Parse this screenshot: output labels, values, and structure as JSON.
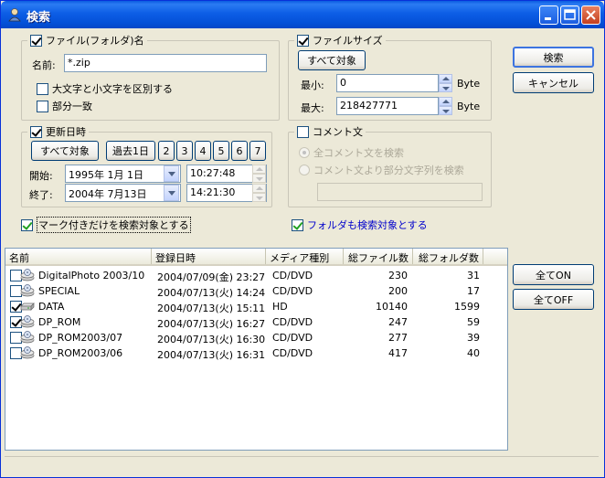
{
  "window": {
    "title": "検索"
  },
  "file_group": {
    "legend": "ファイル(フォルダ)名",
    "name_label": "名前:",
    "name_value": "*.zip",
    "case_label": "大文字と小文字を区別する",
    "partial_label": "部分一致"
  },
  "size_group": {
    "legend": "ファイルサイズ",
    "all_button": "すべて対象",
    "min_label": "最小:",
    "min_value": "0",
    "max_label": "最大:",
    "max_value": "218427771",
    "unit": "Byte"
  },
  "date_group": {
    "legend": "更新日時",
    "all_button": "すべて対象",
    "past_button": "過去1日",
    "day_buttons": [
      "2",
      "3",
      "4",
      "5",
      "6",
      "7"
    ],
    "start_label": "開始:",
    "start_date": "1995年  1月  1日",
    "start_time": "10:27:48",
    "end_label": "終了:",
    "end_date": "2004年  7月13日",
    "end_time": "14:21:30"
  },
  "comment_group": {
    "legend": "コメント文",
    "option_all": "全コメント文を検索",
    "option_partial": "コメント文より部分文字列を検索",
    "text_value": ""
  },
  "options": {
    "marked_only": "マーク付きだけを検索対象とする",
    "include_folders": "フォルダも検索対象とする"
  },
  "buttons": {
    "search": "検索",
    "cancel": "キャンセル",
    "all_on": "全てON",
    "all_off": "全てOFF"
  },
  "list": {
    "columns": [
      "名前",
      "登録日時",
      "メディア種別",
      "総ファイル数",
      "総フォルダ数"
    ],
    "rows": [
      {
        "checked": false,
        "name": "DigitalPhoto 2003/10",
        "date": "2004/07/09(金) 23:27",
        "media": "CD/DVD",
        "files": "230",
        "folders": "31"
      },
      {
        "checked": false,
        "name": "SPECIAL",
        "date": "2004/07/13(火) 14:24",
        "media": "CD/DVD",
        "files": "200",
        "folders": "17"
      },
      {
        "checked": true,
        "name": "DATA",
        "date": "2004/07/13(火) 15:11",
        "media": "HD",
        "files": "10140",
        "folders": "1599"
      },
      {
        "checked": true,
        "name": "DP_ROM",
        "date": "2004/07/13(火) 16:27",
        "media": "CD/DVD",
        "files": "247",
        "folders": "59"
      },
      {
        "checked": false,
        "name": "DP_ROM2003/07",
        "date": "2004/07/13(火) 16:30",
        "media": "CD/DVD",
        "files": "277",
        "folders": "39"
      },
      {
        "checked": false,
        "name": "DP_ROM2003/06",
        "date": "2004/07/13(火) 16:31",
        "media": "CD/DVD",
        "files": "417",
        "folders": "40"
      }
    ]
  },
  "colors": {
    "titlebar": "#0a5be0",
    "face": "#ece9d8",
    "link_blue": "#0000cc"
  }
}
